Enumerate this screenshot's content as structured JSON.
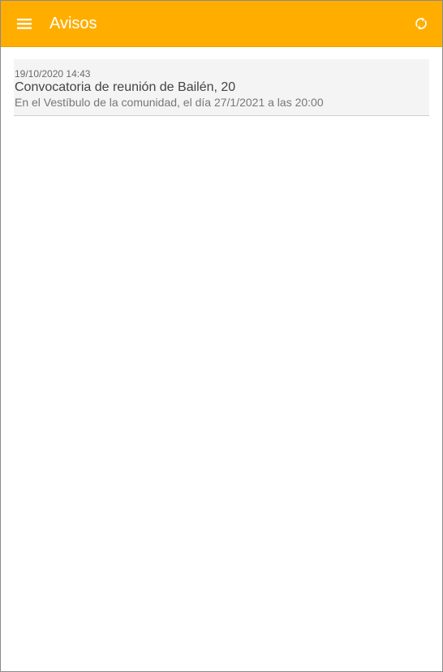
{
  "header": {
    "title": "Avisos",
    "menu_icon": "hamburger-menu-icon",
    "refresh_icon": "refresh-icon"
  },
  "colors": {
    "toolbar": "#ffae00",
    "toolbar_text": "#ffffff",
    "card_background": "#f4f4f4"
  },
  "notices": [
    {
      "date": "19/10/2020 14:43",
      "title": "Convocatoria de reunión de Bailén, 20",
      "body": "En el Vestíbulo de la comunidad, el día 27/1/2021 a las 20:00"
    }
  ]
}
